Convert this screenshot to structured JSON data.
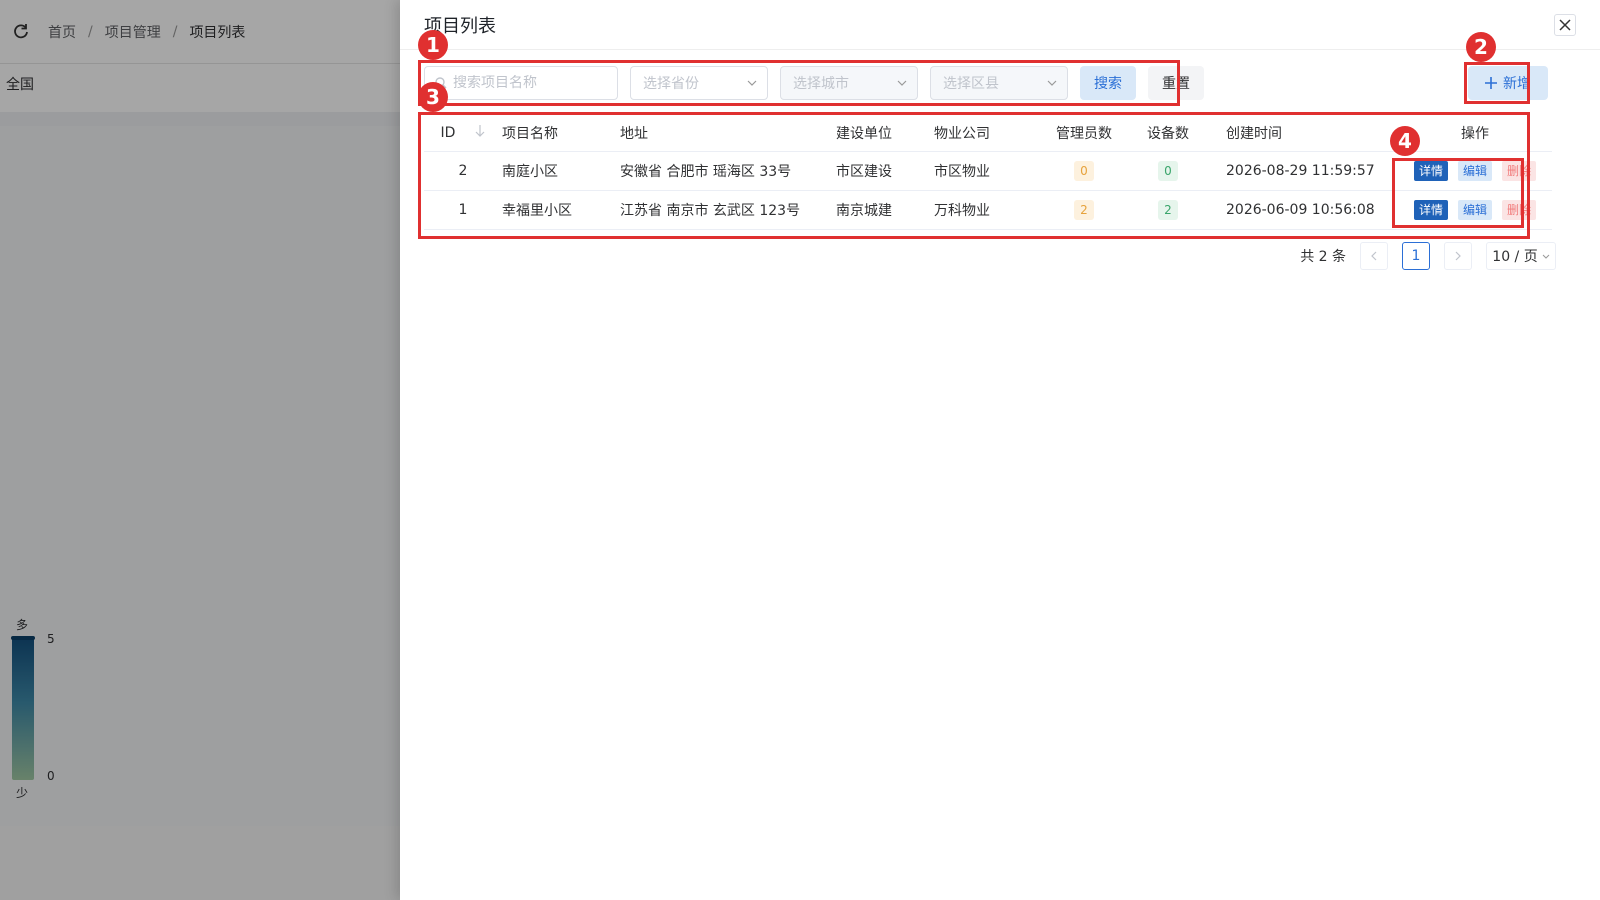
{
  "background": {
    "breadcrumb": [
      "首页",
      "项目管理",
      "项目列表"
    ],
    "region": "全国",
    "legend": {
      "top_label": "多",
      "bottom_label": "少",
      "max": "5",
      "min": "0"
    }
  },
  "drawer": {
    "title": "项目列表",
    "search_placeholder": "搜索项目名称",
    "province_placeholder": "选择省份",
    "city_placeholder": "选择城市",
    "district_placeholder": "选择区县",
    "search_label": "搜索",
    "reset_label": "重置",
    "add_label": "新增"
  },
  "table": {
    "headers": [
      "ID",
      "项目名称",
      "地址",
      "建设单位",
      "物业公司",
      "管理员数",
      "设备数",
      "创建时间",
      "操作"
    ],
    "rows": [
      {
        "id": "2",
        "name": "南庭小区",
        "address": "安徽省 合肥市 瑶海区 33号",
        "builder": "市区建设",
        "property": "市区物业",
        "admins": "0",
        "devices": "0",
        "created": "2026-08-29 11:59:57"
      },
      {
        "id": "1",
        "name": "幸福里小区",
        "address": "江苏省 南京市 玄武区 123号",
        "builder": "南京城建",
        "property": "万科物业",
        "admins": "2",
        "devices": "2",
        "created": "2026-06-09 10:56:08"
      }
    ],
    "ops": {
      "detail": "详情",
      "edit": "编辑",
      "delete": "删除"
    }
  },
  "pagination": {
    "total_text": "共 2 条",
    "current_page": "1",
    "page_size": "10 / 页"
  },
  "annotations": [
    "1",
    "2",
    "3",
    "4"
  ],
  "colors": {
    "accent": "#2b6fd6",
    "annotation": "#e03030",
    "detail_button": "#1f62b8"
  }
}
